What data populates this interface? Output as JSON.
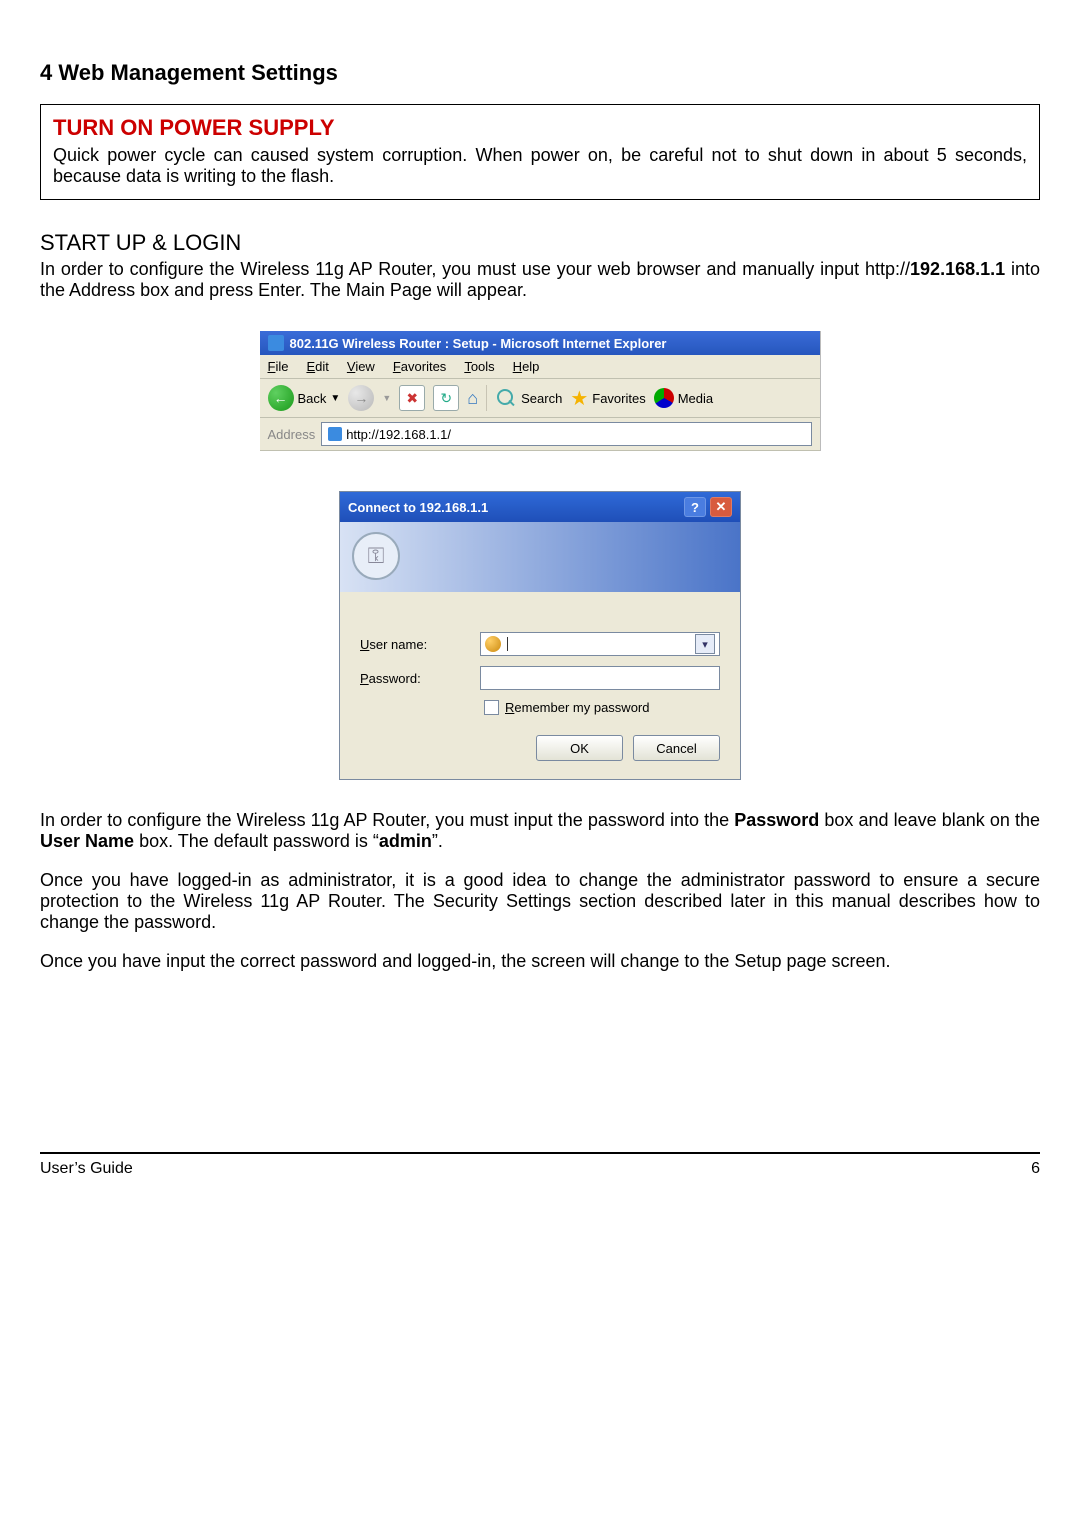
{
  "heading": "4 Web Management Settings",
  "warn": {
    "title": "TURN ON POWER SUPPLY",
    "text": "Quick power cycle can caused system corruption. When power on, be careful not to shut down in about 5 seconds, because data is writing to the flash."
  },
  "startup": {
    "title": "START UP & LOGIN",
    "text_a": "In order to configure the Wireless 11g AP Router, you must use your web browser and manually input http://",
    "ip_bold": "192.168.1.1",
    "text_b": " into the Address box and press Enter. The Main Page will appear."
  },
  "ie": {
    "title": "802.11G Wireless Router : Setup - Microsoft Internet Explorer",
    "menus": [
      "File",
      "Edit",
      "View",
      "Favorites",
      "Tools",
      "Help"
    ],
    "back": "Back",
    "search": "Search",
    "favorites": "Favorites",
    "media": "Media",
    "address_label": "Address",
    "address_value": "http://192.168.1.1/"
  },
  "auth": {
    "title": "Connect to 192.168.1.1",
    "username_label": "User name:",
    "password_label": "Password:",
    "remember": "Remember my password",
    "ok": "OK",
    "cancel": "Cancel"
  },
  "after": {
    "p1_a": "In order to configure the Wireless 11g AP Router, you must input the password into the ",
    "p1_b": "Password",
    "p1_c": " box and leave blank on the ",
    "p1_d": "User Name",
    "p1_e": " box. The default password is “",
    "p1_f": "admin",
    "p1_g": "”.",
    "p2": "Once you have logged-in as administrator, it is a good idea to change the administrator password to ensure a secure protection to the Wireless 11g AP Router. The Security Settings section described later in this manual describes how to change the password.",
    "p3": "Once you have input the correct password and logged-in, the screen will change to the Setup page screen."
  },
  "footer": {
    "left": "User’s Guide",
    "right": "6"
  }
}
